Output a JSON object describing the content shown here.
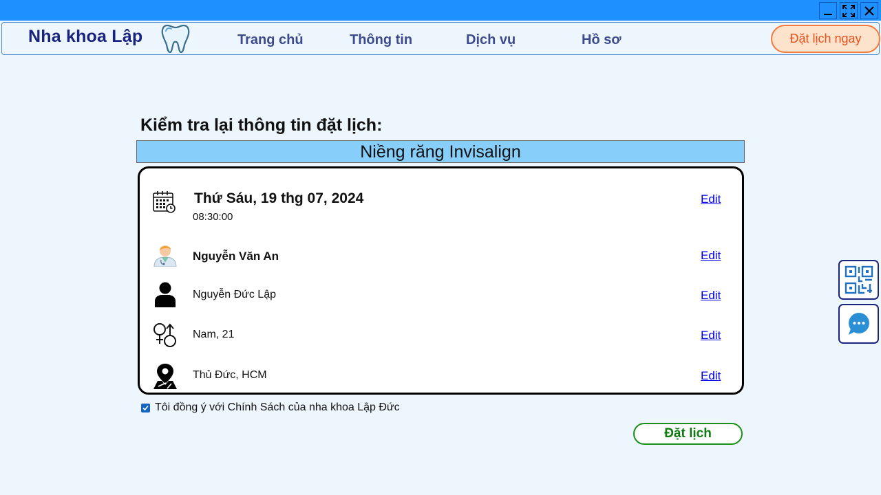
{
  "window": {
    "minimize_icon": "minimize-icon",
    "maximize_icon": "fullscreen-icon",
    "close_icon": "close-icon"
  },
  "header": {
    "brand": "Nha khoa Lập",
    "logo_icon": "tooth-icon",
    "nav": [
      "Trang chủ",
      "Thông tin",
      "Dịch vụ",
      "Hồ sơ"
    ],
    "cta_label": "Đặt lịch ngay"
  },
  "booking": {
    "heading": "Kiểm tra lại thông tin đặt lịch:",
    "service": "Niềng răng Invisalign",
    "date": "Thứ Sáu, 19 thg 07, 2024",
    "time": "08:30:00",
    "doctor": "Nguyễn Văn An",
    "patient": "Nguyễn Đức Lập",
    "gender_age": "Nam, 21",
    "location": "Thủ Đức, HCM",
    "edit_label": "Edit"
  },
  "agreement": {
    "checked": true,
    "label": "Tôi đồng ý với Chính Sách của nha khoa Lập Đức"
  },
  "submit_label": "Đặt lịch",
  "side": {
    "qr_icon": "qr-code-icon",
    "chat_icon": "chat-icon"
  },
  "colors": {
    "titlebar": "#1e90ff",
    "service_bar": "#87cefa",
    "cta_border": "#f4793b",
    "submit_border": "#1a8f1a",
    "link": "#0000ee"
  }
}
